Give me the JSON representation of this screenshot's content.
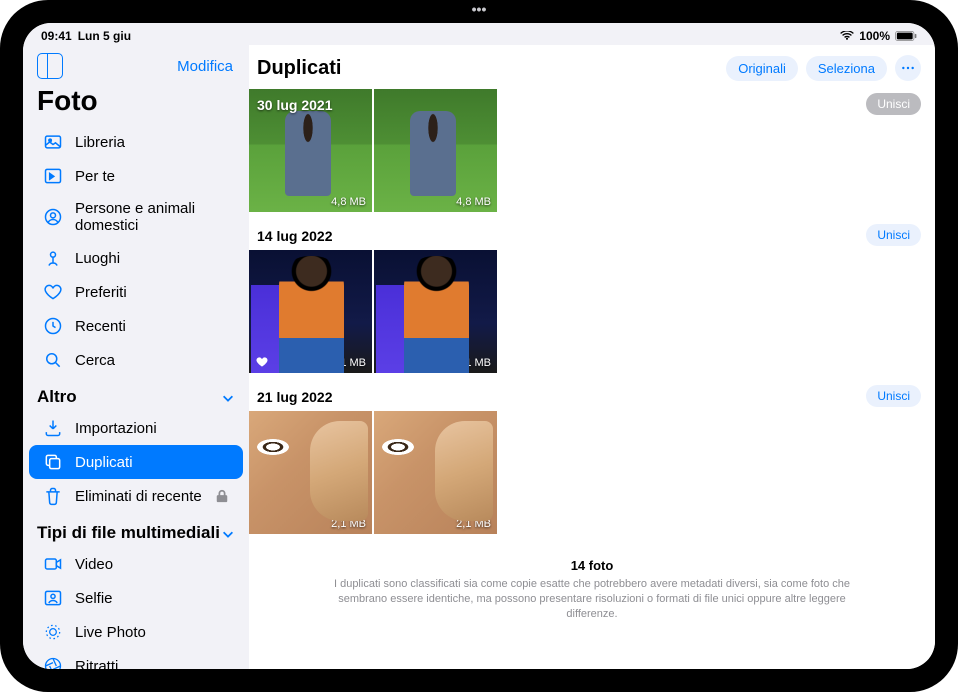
{
  "statusbar": {
    "time": "09:41",
    "date": "Lun 5 giu",
    "wifi_icon": "wifi",
    "battery_pct": "100%"
  },
  "sidebar": {
    "modify_label": "Modifica",
    "app_title": "Foto",
    "items": [
      {
        "label": "Libreria"
      },
      {
        "label": "Per te"
      },
      {
        "label": "Persone e animali domestici"
      },
      {
        "label": "Luoghi"
      },
      {
        "label": "Preferiti"
      },
      {
        "label": "Recenti"
      },
      {
        "label": "Cerca"
      }
    ],
    "section_altro": "Altro",
    "altro_items": [
      {
        "label": "Importazioni"
      },
      {
        "label": "Duplicati"
      },
      {
        "label": "Eliminati di recente"
      }
    ],
    "section_media": "Tipi di file multimediali",
    "media_items": [
      {
        "label": "Video"
      },
      {
        "label": "Selfie"
      },
      {
        "label": "Live Photo"
      },
      {
        "label": "Ritratti"
      }
    ]
  },
  "content": {
    "title": "Duplicati",
    "btn_originali": "Originali",
    "btn_seleziona": "Seleziona",
    "groups": [
      {
        "date": "30 lug 2021",
        "merge_label": "Unisci",
        "photos": [
          {
            "size": "4,8 MB"
          },
          {
            "size": "4,8 MB"
          }
        ]
      },
      {
        "date": "14 lug 2022",
        "merge_label": "Unisci",
        "photos": [
          {
            "size": "1,1 MB",
            "favorite": true
          },
          {
            "size": "1,1 MB"
          }
        ]
      },
      {
        "date": "21 lug 2022",
        "merge_label": "Unisci",
        "photos": [
          {
            "size": "2,1 MB"
          },
          {
            "size": "2,1 MB"
          }
        ]
      }
    ],
    "footer_count": "14 foto",
    "footer_desc": "I duplicati sono classificati sia come copie esatte che potrebbero avere metadati diversi, sia come foto che sembrano essere identiche, ma possono presentare risoluzioni o formati di file unici oppure altre leggere differenze."
  }
}
